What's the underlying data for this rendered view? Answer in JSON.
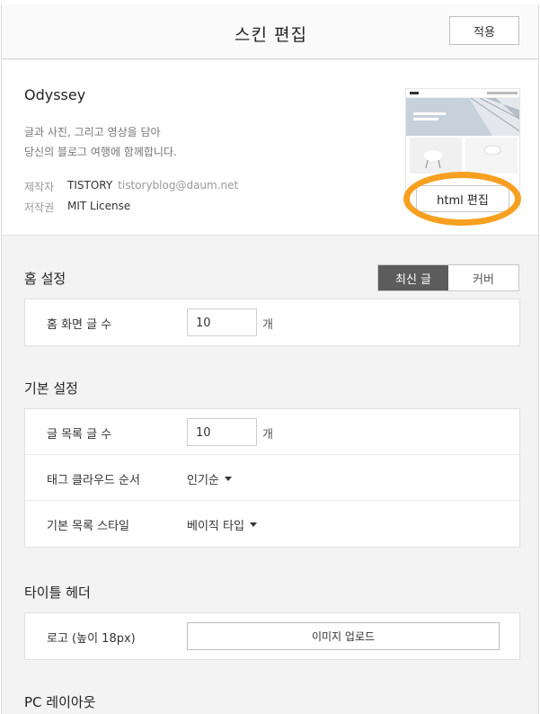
{
  "header": {
    "title": "스킨 편집",
    "apply_label": "적용"
  },
  "skin": {
    "name": "Odyssey",
    "description_line1": "글과 사진, 그리고 영상을 담아",
    "description_line2": "당신의 블로그 여행에 함께합니다.",
    "author_key": "제작자",
    "author_name": "TISTORY",
    "author_email": "tistoryblog@daum.net",
    "license_key": "저작권",
    "license_value": "MIT License",
    "edit_html_label": "html 편집",
    "highlight_color": "#f7a020"
  },
  "home_settings": {
    "title": "홈 설정",
    "toggle": [
      "최신 글",
      "커버"
    ],
    "active_toggle": "최신 글",
    "posts_label": "홈 화면 글 수",
    "posts_value": "10",
    "unit": "개"
  },
  "basic_settings": {
    "title": "기본 설정",
    "list_count_label": "글 목록 글 수",
    "list_count_value": "10",
    "unit": "개",
    "tag_cloud_label": "태그 클라우드 순서",
    "tag_cloud_value": "인기순",
    "list_style_label": "기본 목록 스타일",
    "list_style_value": "베이직 타입"
  },
  "title_header": {
    "title": "타이틀 헤더",
    "logo_label": "로고 (높이 18px)",
    "upload_label": "이미지 업로드"
  },
  "pc_layout": {
    "title": "PC 레이아웃"
  }
}
